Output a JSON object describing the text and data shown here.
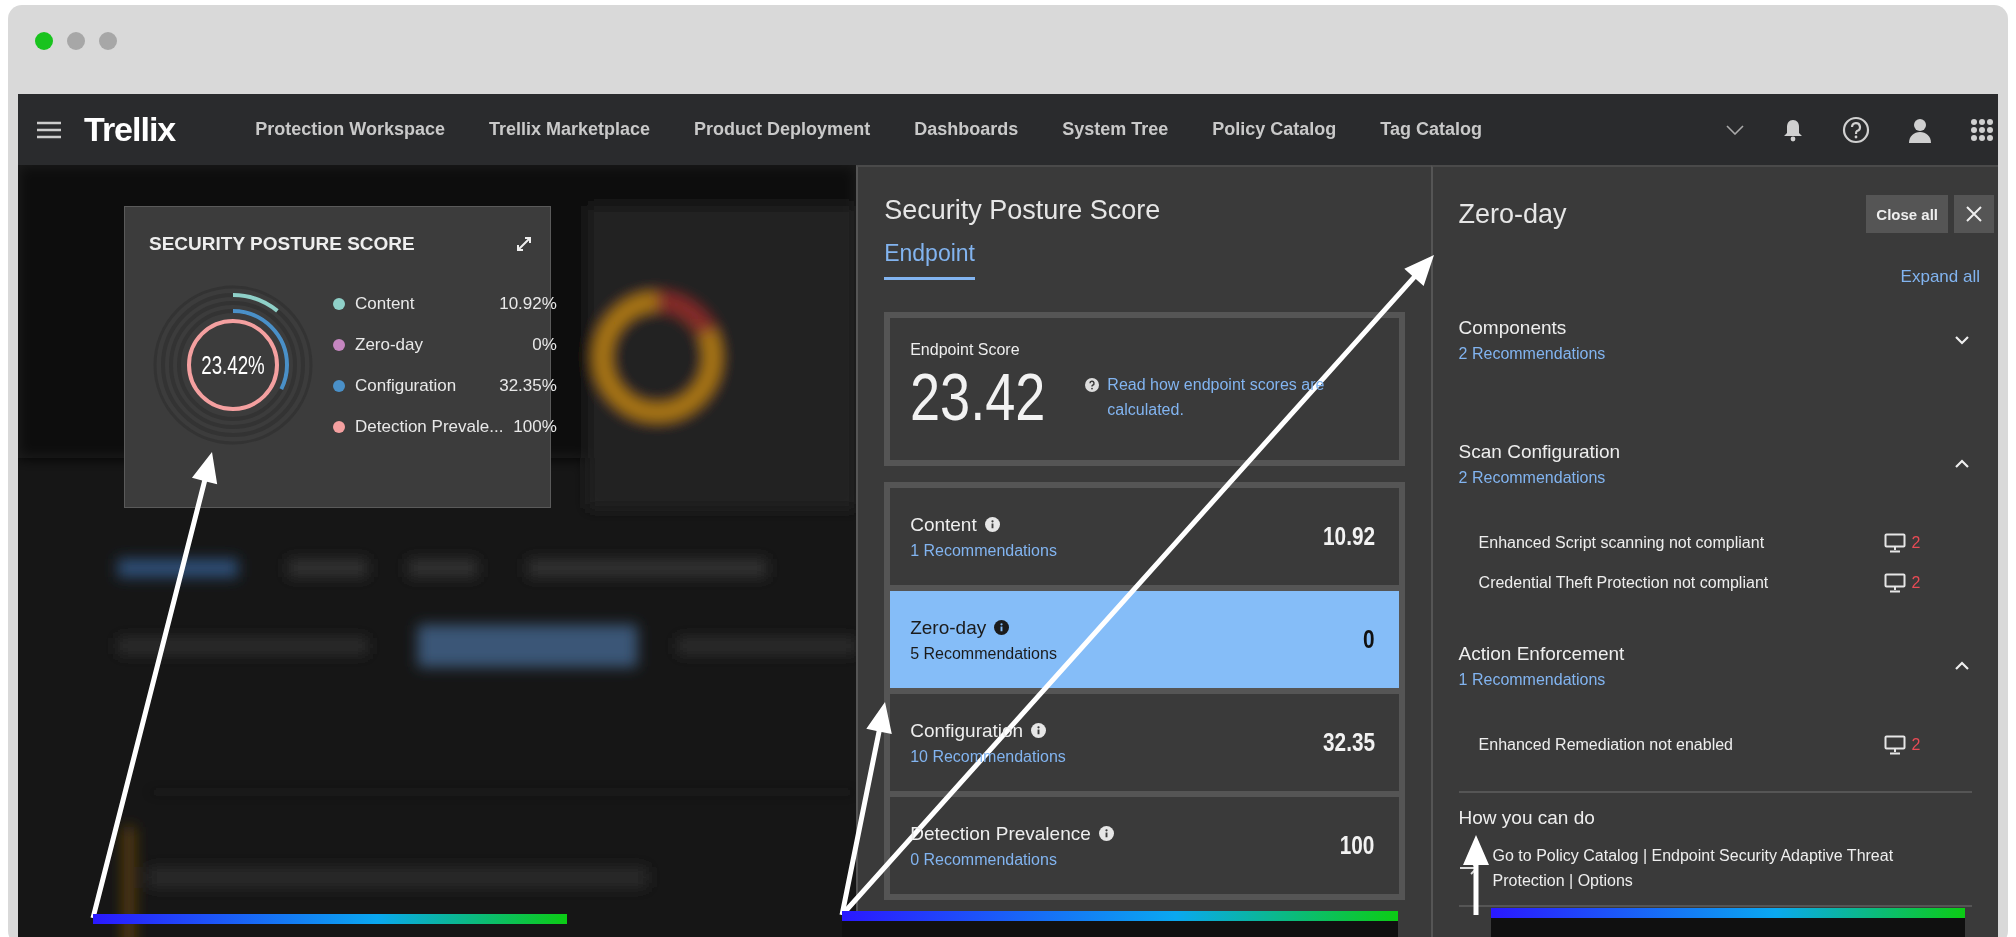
{
  "nav": {
    "brand": "Trellix",
    "items": [
      "Protection Workspace",
      "Trellix Marketplace",
      "Product Deployment",
      "Dashboards",
      "System Tree",
      "Policy Catalog",
      "Tag Catalog"
    ]
  },
  "score_card": {
    "title": "SECURITY POSTURE SCORE",
    "center": "23.42%",
    "legend": [
      {
        "name": "Content",
        "value": "10.92%",
        "color": "#8fd0c8"
      },
      {
        "name": "Zero-day",
        "value": "0%",
        "color": "#c586c0"
      },
      {
        "name": "Configuration",
        "value": "32.35%",
        "color": "#4a90c8"
      },
      {
        "name": "Detection Prevale...",
        "value": "100%",
        "color": "#f4a0a0"
      }
    ]
  },
  "posture_panel": {
    "title": "Security Posture Score",
    "tabs": [
      {
        "label": "Endpoint",
        "selected": true
      }
    ],
    "endpoint": {
      "label": "Endpoint Score",
      "score": "23.42",
      "link": "Read how endpoint scores are calculated."
    },
    "categories": [
      {
        "name": "Content",
        "recommendations": "1 Recommendations",
        "value": "10.92",
        "selected": false
      },
      {
        "name": "Zero-day",
        "recommendations": "5 Recommendations",
        "value": "0",
        "selected": true
      },
      {
        "name": "Configuration",
        "recommendations": "10 Recommendations",
        "value": "32.35",
        "selected": false
      },
      {
        "name": "Detection Prevalence",
        "recommendations": "0 Recommendations",
        "value": "100",
        "selected": false
      }
    ]
  },
  "detail_panel": {
    "title": "Zero-day",
    "close_all": "Close all",
    "expand_all": "Expand all",
    "sections": [
      {
        "name": "Components",
        "recommendations": "2 Recommendations",
        "expanded": false
      },
      {
        "name": "Scan Configuration",
        "recommendations": "2 Recommendations",
        "expanded": true,
        "items": [
          {
            "text": "Enhanced Script scanning not compliant",
            "count": "2"
          },
          {
            "text": "Credential Theft Protection not compliant",
            "count": "2"
          }
        ]
      },
      {
        "name": "Action Enforcement",
        "recommendations": "1 Recommendations",
        "expanded": true,
        "items": [
          {
            "text": "Enhanced Remediation not enabled",
            "count": "2"
          }
        ]
      }
    ],
    "how_title": "How you can do",
    "how_text": "Go to Policy Catalog | Endpoint Security Adaptive Threat Protection | Options"
  }
}
